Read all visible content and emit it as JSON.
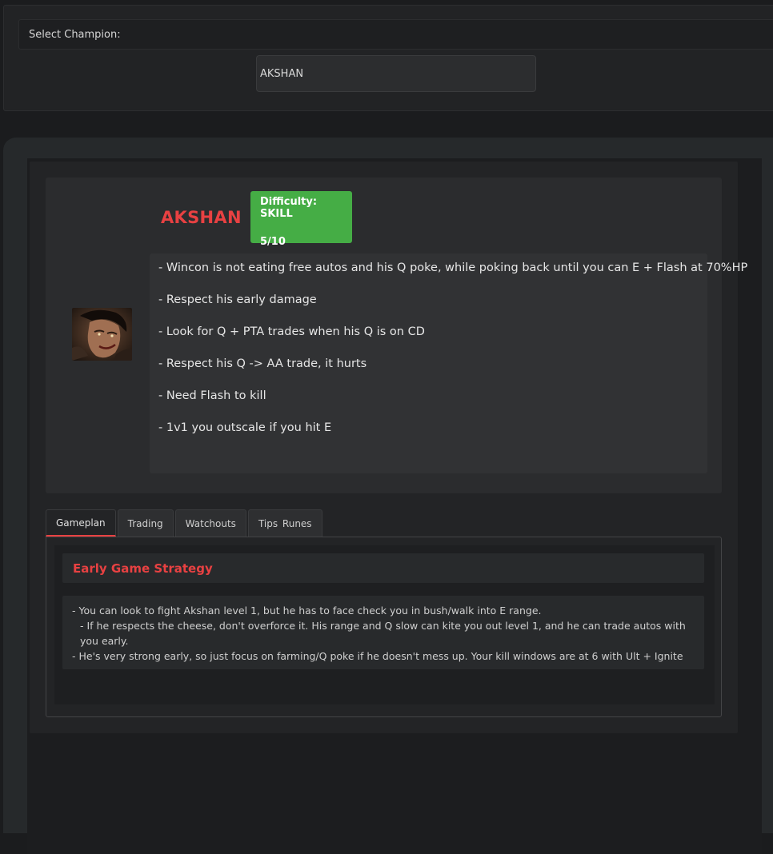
{
  "selector": {
    "label": "Select Champion:",
    "selected": "AKSHAN"
  },
  "champion": {
    "name": "AKSHAN",
    "difficulty_line1": "Difficulty: SKILL",
    "difficulty_line2": "5/10",
    "notes": [
      "- Wincon is not eating free autos and his Q poke, while poking back until you can E + Flash at 70%HP",
      "- Respect his early damage",
      "- Look for Q + PTA trades when his Q is on CD",
      "- Respect his Q -> AA trade, it hurts",
      "- Need Flash to kill",
      "- 1v1 you outscale if you hit E"
    ]
  },
  "tabs": [
    {
      "label": "Gameplan"
    },
    {
      "label": "Trading"
    },
    {
      "label": "Watchouts"
    },
    {
      "label": "Tips Runes"
    }
  ],
  "gameplan": {
    "title": "Early Game Strategy",
    "lines": [
      "- You can look to fight Akshan level 1, but he has to face check you in bush/walk into E range.",
      "- If he respects the cheese, don't overforce it. His range and Q slow can kite you out level 1, and he can trade autos with you early.",
      "- He's very strong early, so just focus on farming/Q poke if he doesn't mess up. Your kill windows are at 6 with Ult + Ignite"
    ]
  },
  "colors": {
    "accent_red": "#e84142",
    "difficulty_green": "#45ad45"
  }
}
